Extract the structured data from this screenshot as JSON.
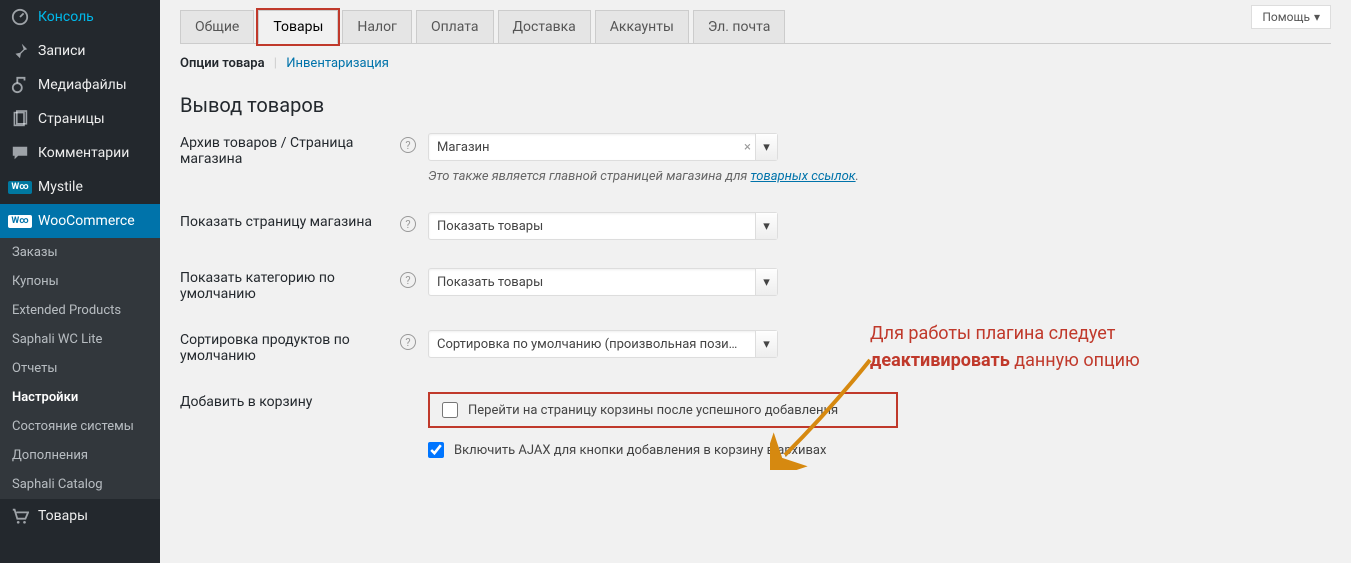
{
  "help_label": "Помощь",
  "sidebar": {
    "main": [
      {
        "icon": "dash",
        "label": "Консоль"
      },
      {
        "icon": "pin",
        "label": "Записи"
      },
      {
        "icon": "media",
        "label": "Медиафайлы"
      },
      {
        "icon": "page",
        "label": "Страницы"
      },
      {
        "icon": "comment",
        "label": "Комментарии"
      },
      {
        "icon": "mystile",
        "label": "Mystile"
      }
    ],
    "woo_label": "WooCommerce",
    "sub": [
      "Заказы",
      "Купоны",
      "Extended Products",
      "Saphali WC Lite",
      "Отчеты",
      "Настройки",
      "Состояние системы",
      "Дополнения",
      "Saphali Catalog"
    ],
    "products_label": "Товары"
  },
  "tabs": [
    "Общие",
    "Товары",
    "Налог",
    "Оплата",
    "Доставка",
    "Аккаунты",
    "Эл. почта"
  ],
  "subnav": {
    "current": "Опции товара",
    "link": "Инвентаризация"
  },
  "heading": "Вывод товаров",
  "rows": {
    "shop_page": {
      "label": "Архив товаров / Страница магазина",
      "value": "Магазин",
      "desc_prefix": "Это также является главной страницей магазина для ",
      "desc_link": "товарных ссылок",
      "desc_suffix": "."
    },
    "show_page": {
      "label": "Показать страницу магазина",
      "value": "Показать товары"
    },
    "show_cat": {
      "label": "Показать категорию по умолчанию",
      "value": "Показать товары"
    },
    "sort": {
      "label": "Сортировка продуктов по умолчанию",
      "value": "Сортировка по умолчанию (произвольная пози…"
    },
    "cart": {
      "label": "Добавить в корзину",
      "opt1": "Перейти на страницу корзины после успешного добавления",
      "opt2": "Включить AJAX для кнопки добавления в корзину в архивах"
    }
  },
  "annotation": {
    "line1": "Для работы плагина следует",
    "bold": "деактивировать",
    "line2_rest": " данную опцию"
  }
}
